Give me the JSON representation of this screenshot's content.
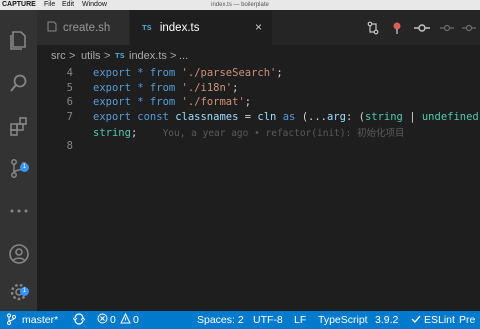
{
  "menubar": {
    "app": "CAPTURE",
    "file": "File",
    "edit": "Edit",
    "window": "Window",
    "title": "index.ts — boilerplate"
  },
  "activity_bar": {
    "items": [
      {
        "name": "explorer-icon",
        "active": false
      },
      {
        "name": "search-icon",
        "active": false
      },
      {
        "name": "extensions-icon",
        "active": false
      },
      {
        "name": "source-control-icon",
        "active": true,
        "badge": "1"
      },
      {
        "name": "more-icon",
        "active": false
      },
      {
        "name": "account-icon",
        "active": false
      },
      {
        "name": "settings-gear-icon",
        "active": false,
        "badge": "1"
      }
    ]
  },
  "tabs": [
    {
      "label": "create.sh",
      "active": false
    },
    {
      "label": "index.ts",
      "icon_text": "TS",
      "active": true,
      "close": "×"
    }
  ],
  "breadcrumb": {
    "parts": [
      "src",
      "utils",
      "index.ts",
      "..."
    ],
    "separator": ">",
    "ts_label": "TS"
  },
  "editor": {
    "lines": [
      {
        "number": "4"
      },
      {
        "number": "5"
      },
      {
        "number": "6"
      },
      {
        "number": "7"
      },
      {
        "number": ""
      },
      {
        "number": "8"
      }
    ],
    "code": {
      "l4_kw": "export",
      "l4_op": "*",
      "l4_from": "from",
      "l4_str": "'./parseSearch'",
      "l4_end": ";",
      "l5_kw": "export",
      "l5_op": "*",
      "l5_from": "from",
      "l5_str": "'./i18n'",
      "l5_end": ";",
      "l6_kw": "export",
      "l6_op": "*",
      "l6_from": "from",
      "l6_str": "'./format'",
      "l6_end": ";",
      "l7_kw": "export",
      "l7_const": "const",
      "l7_name": "classnames",
      "l7_eq": "=",
      "l7_fn": "cln",
      "l7_as": "as",
      "l7_open": "(...",
      "l7_arg": "arg",
      "l7_colon": ":",
      "l7_p": "(",
      "l7_t1": "string",
      "l7_pipe": "|",
      "l7_t2": "undefined",
      "l7_close": ")[])",
      "l7b_type": "string",
      "l7b_end": ";",
      "blame": "You, a year ago • refactor(init): 初始化项目"
    }
  },
  "status_bar": {
    "branch": "master*",
    "errors": "0",
    "warnings": "0",
    "spaces": "Spaces: 2",
    "encoding": "UTF-8",
    "eol": "LF",
    "language": "TypeScript",
    "version": "3.9.2",
    "eslint": "ESLint",
    "prettier": "Pre"
  },
  "colors": {
    "accent": "#007acc",
    "editor_bg": "#1e1e1e",
    "activity_bg": "#333333",
    "tab_bg": "#252526"
  }
}
